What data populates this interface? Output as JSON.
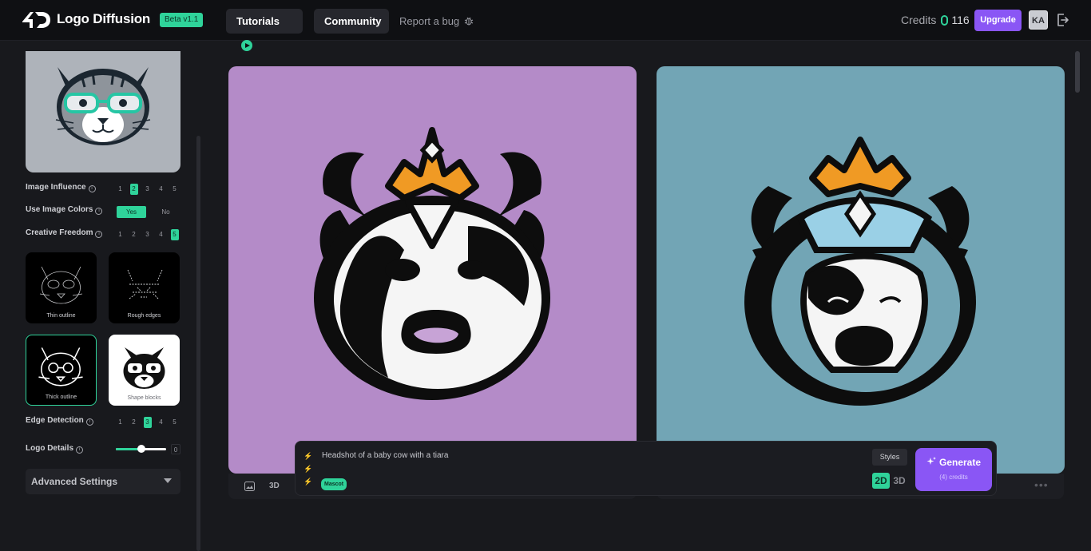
{
  "header": {
    "brand": "Logo Diffusion",
    "beta_badge": "Beta v1.1",
    "tutorials": "Tutorials",
    "community": "Community",
    "report_bug": "Report a bug",
    "credits_label": "Credits",
    "credits_value": "116",
    "upgrade": "Upgrade",
    "avatar_initials": "KA"
  },
  "sidebar": {
    "image_influence": {
      "label": "Image Influence",
      "options": [
        "1",
        "2",
        "3",
        "4",
        "5"
      ],
      "selected": "2"
    },
    "use_image_colors": {
      "label": "Use Image Colors",
      "options": [
        "Yes",
        "No"
      ],
      "selected": "Yes"
    },
    "creative_freedom": {
      "label": "Creative Freedom",
      "options": [
        "1",
        "2",
        "3",
        "4",
        "5"
      ],
      "selected": "5"
    },
    "styles": [
      "Thin outline",
      "Rough edges",
      "Thick outline",
      "Shape blocks"
    ],
    "selected_style": "Thick outline",
    "edge_detection": {
      "label": "Edge Detection",
      "options": [
        "1",
        "2",
        "3",
        "4",
        "5"
      ],
      "selected": "3"
    },
    "logo_details": {
      "label": "Logo Details",
      "value": "0",
      "slider_fraction": 0.5
    },
    "advanced_settings": "Advanced Settings"
  },
  "card_footer": {
    "dim_label": "3D"
  },
  "prompt": {
    "text": "Headshot of a baby cow with a tiara",
    "tag": "Mascot",
    "styles_button": "Styles",
    "dim_2d": "2D",
    "dim_3d": "3D",
    "generate": "Generate",
    "generate_sub": "(4) credits"
  },
  "colors": {
    "accent_green": "#2fd39a",
    "accent_purple": "#8a56f5",
    "card1_bg": "#b48bc8",
    "card2_bg": "#72a5b5"
  }
}
